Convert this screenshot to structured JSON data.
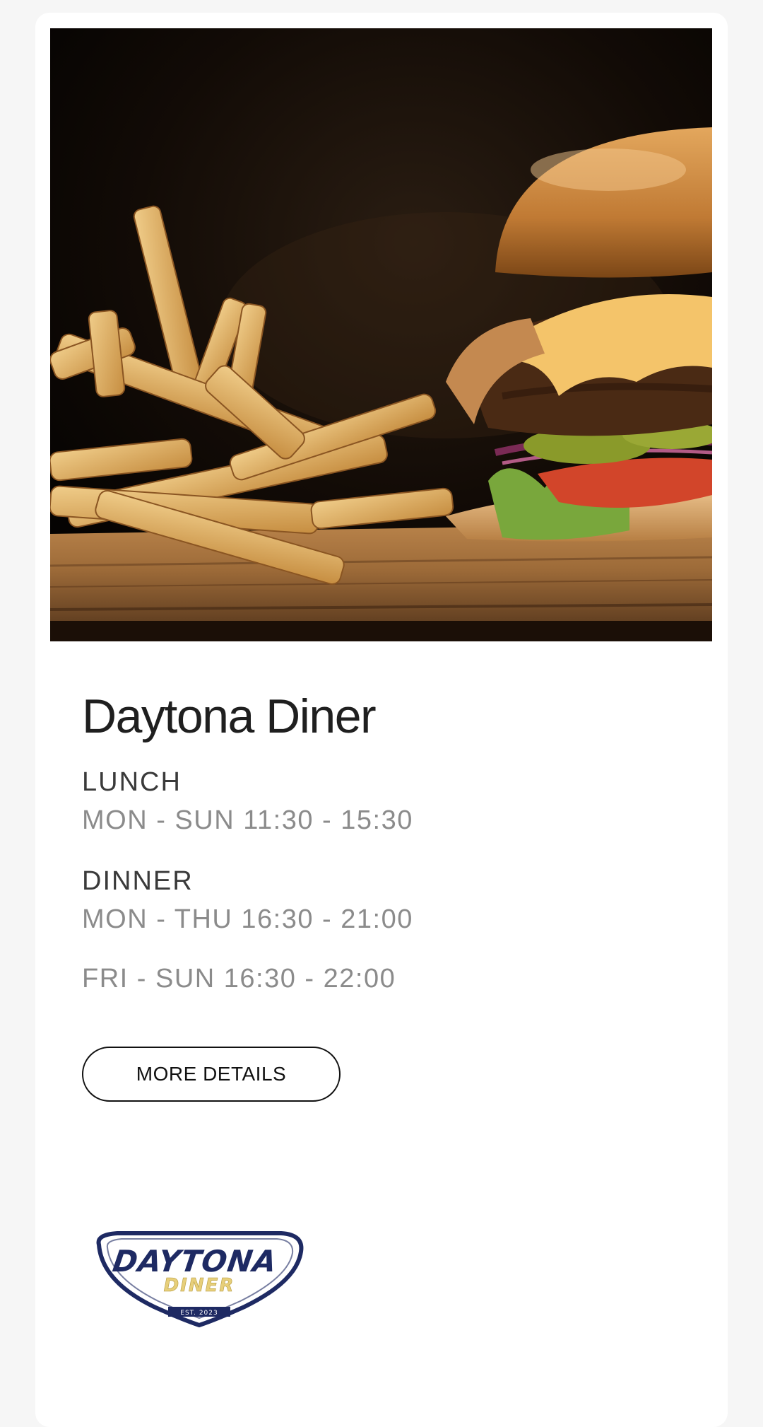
{
  "restaurant": {
    "name": "Daytona Diner"
  },
  "lunch": {
    "label": "LUNCH",
    "hours": "MON - SUN 11:30 - 15:30"
  },
  "dinner": {
    "label": "DINNER",
    "hours_weekday": "MON - THU 16:30 - 21:00",
    "hours_weekend": "FRI - SUN 16:30 - 22:00"
  },
  "actions": {
    "more_details": "MORE DETAILS"
  },
  "logo": {
    "word_main": "DAYTONA",
    "word_sub": "DINER",
    "established": "EST. 2023"
  },
  "colors": {
    "logo_navy": "#1e2a63",
    "logo_gold": "#e7cf7a",
    "page_bg": "#f6f6f6"
  }
}
